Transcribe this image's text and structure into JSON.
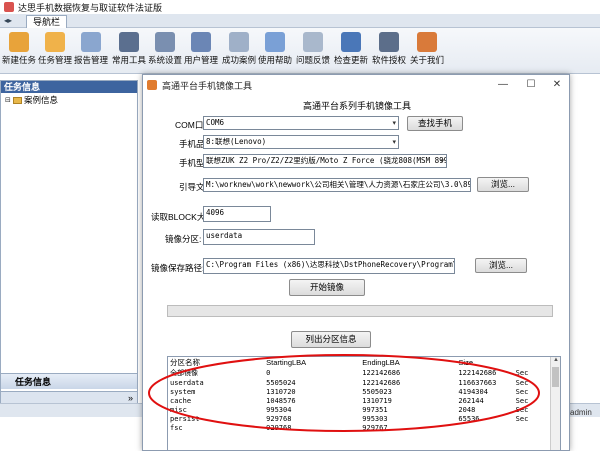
{
  "app": {
    "title": "达思手机数据恢复与取证软件法证版",
    "nav_tab": "导航栏",
    "nav_arrow": "◂▸",
    "admin": "admin"
  },
  "toolbar": {
    "items": [
      {
        "label": "新建任务",
        "icon": "new-task-icon",
        "color": "#e8a33a"
      },
      {
        "label": "任务管理",
        "icon": "task-manage-icon",
        "color": "#f0b24a"
      },
      {
        "label": "报告管理",
        "icon": "report-icon",
        "color": "#8aa6cf"
      },
      {
        "label": "常用工具",
        "icon": "tools-icon",
        "color": "#5b6f8f"
      },
      {
        "label": "系统设置",
        "icon": "settings-icon",
        "color": "#7a8fb0"
      },
      {
        "label": "用户管理",
        "icon": "user-manage-icon",
        "color": "#6b86b5"
      },
      {
        "label": "成功案例",
        "icon": "success-case-icon",
        "color": "#9fb0c8"
      },
      {
        "label": "使用帮助",
        "icon": "help-icon",
        "color": "#7aa0d6"
      },
      {
        "label": "问题反馈",
        "icon": "feedback-icon",
        "color": "#a9b8cc"
      },
      {
        "label": "检查更新",
        "icon": "update-icon",
        "color": "#4a77b8"
      },
      {
        "label": "软件授权",
        "icon": "license-icon",
        "color": "#5c6e8a"
      },
      {
        "label": "关于我们",
        "icon": "about-icon",
        "color": "#d97a3a"
      }
    ]
  },
  "left_panel": {
    "header": "任务信息",
    "tree_item": "案例信息",
    "bottom_label": "任务信息",
    "chevron": "»"
  },
  "dialog": {
    "title": "高通平台手机镜像工具",
    "heading": "高通平台系列手机镜像工具",
    "com_label": "COM口选择:",
    "com_value": "COM6",
    "find_phone": "查找手机",
    "brand_label": "手机品牌:",
    "brand_value": "8:联想(Lenovo)",
    "model_label": "手机型号:",
    "model_value": "联想ZUK Z2 Pro/Z2/Z2里约版/Moto Z Force (骁龙808(MSM 8992))",
    "boot_label": "引导文件:",
    "boot_value": "M:\\worknew\\work\\newwork\\公司相关\\管理\\人力资源\\石家庄公司\\3.0\\8974(1).mbn",
    "browse1": "浏览...",
    "block_label": "读取BLOCK大小:",
    "block_value": "4096",
    "partition_label": "镜像分区:",
    "partition_value": "userdata",
    "save_label": "镜像保存路径:",
    "save_value": "C:\\Program Files (x86)\\达思科技\\DstPhoneRecovery\\Program\\tools\\Qualcomm\\",
    "browse2": "浏览...",
    "start_button": "开始镜像",
    "progress": 0,
    "list_button": "列出分区信息"
  },
  "partitions": {
    "headers": [
      "分区名称",
      "StartingLBA",
      "EndingLBA",
      "Size",
      ""
    ],
    "rows": [
      [
        "全部镜像",
        "0",
        "122142686",
        "122142686",
        "Sec"
      ],
      [
        "userdata",
        "5505024",
        "122142686",
        "116637663",
        "Sec"
      ],
      [
        "system",
        "1310720",
        "5505023",
        "4194304",
        "Sec"
      ],
      [
        "cache",
        "1048576",
        "1310719",
        "262144",
        "Sec"
      ],
      [
        "misc",
        "995304",
        "997351",
        "2048",
        "Sec"
      ],
      [
        "persist",
        "929768",
        "995303",
        "65536",
        "Sec"
      ],
      [
        "fsc",
        "929768",
        "929767",
        "",
        ""
      ]
    ]
  },
  "colors": {
    "annotation": "#e01010",
    "progress_fill": "#06b025",
    "panel_header": "#3d649f"
  }
}
